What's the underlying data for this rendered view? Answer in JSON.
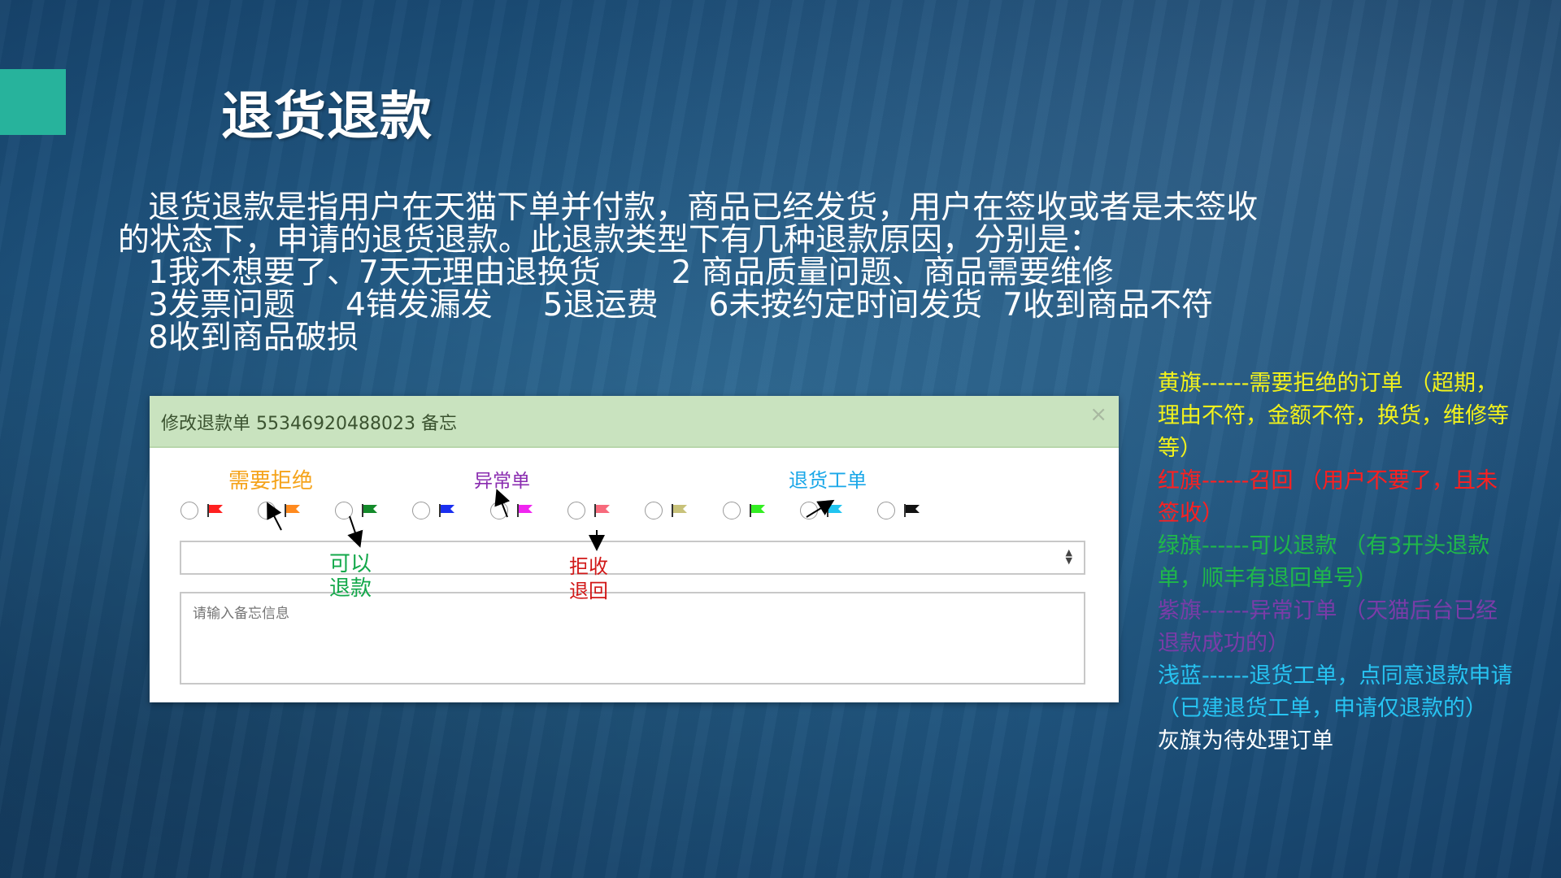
{
  "slide": {
    "title": "退货退款",
    "intro_lines": [
      "   退货退款是指用户在天猫下单并付款，商品已经发货，用户在签收或者是未签收",
      "的状态下，申请的退货退款。此退款类型下有几种退款原因，分别是：",
      "   1我不想要了、7天无理由退换货       2 商品质量问题、商品需要维修",
      "   3发票问题     4错发漏发     5退运费     6未按约定时间发货  7收到商品不符",
      "   8收到商品破损"
    ]
  },
  "dialog": {
    "title": "修改退款单 55346920488023 备忘",
    "close_icon": "×",
    "flags": [
      {
        "name": "red-flag-icon",
        "color": "#ff2020"
      },
      {
        "name": "orange-flag-icon",
        "color": "#ff8a1f"
      },
      {
        "name": "green-flag-icon",
        "color": "#138a2a"
      },
      {
        "name": "blue-flag-icon",
        "color": "#1a2ff0"
      },
      {
        "name": "magenta-flag-icon",
        "color": "#f025f0"
      },
      {
        "name": "pink-flag-icon",
        "color": "#f76a7c"
      },
      {
        "name": "khaki-flag-icon",
        "color": "#c8c27a"
      },
      {
        "name": "lime-flag-icon",
        "color": "#33ee22"
      },
      {
        "name": "cyan-flag-icon",
        "color": "#21c4f0"
      },
      {
        "name": "black-flag-icon",
        "color": "#111111"
      }
    ],
    "select_arrows": "▲▼",
    "note_placeholder": "请输入备忘信息"
  },
  "annotations": {
    "need_reject": {
      "text": "需要拒绝",
      "color": "#f5a31a"
    },
    "exception": {
      "text": "异常单",
      "color": "#8a2cb0"
    },
    "return_ticket": {
      "text": "退货工单",
      "color": "#1aa7e8"
    },
    "can_refund": {
      "text": "可以\n退款",
      "color": "#12a84a"
    },
    "reject_return": {
      "text": "拒收\n退回",
      "color": "#d11818"
    }
  },
  "legend": [
    {
      "text": "黄旗------需要拒绝的订单 （超期，理由不符，金额不符，换货，维修等等）",
      "color": "#f2f21c"
    },
    {
      "text": "红旗------召回     （用户不要了，且未签收）",
      "color": "#ff1f1f"
    },
    {
      "text": "绿旗------可以退款 （有3开头退款单，顺丰有退回单号）",
      "color": "#1fb84a"
    },
    {
      "text": "紫旗------异常订单 （天猫后台已经退款成功的）",
      "color": "#7a3ca8"
    },
    {
      "text": "浅蓝------退货工单，点同意退款申请 （已建退货工单，申请仅退款的）",
      "color": "#27c4f2"
    },
    {
      "text": "灰旗为待处理订单",
      "color": "#ffffff"
    }
  ]
}
